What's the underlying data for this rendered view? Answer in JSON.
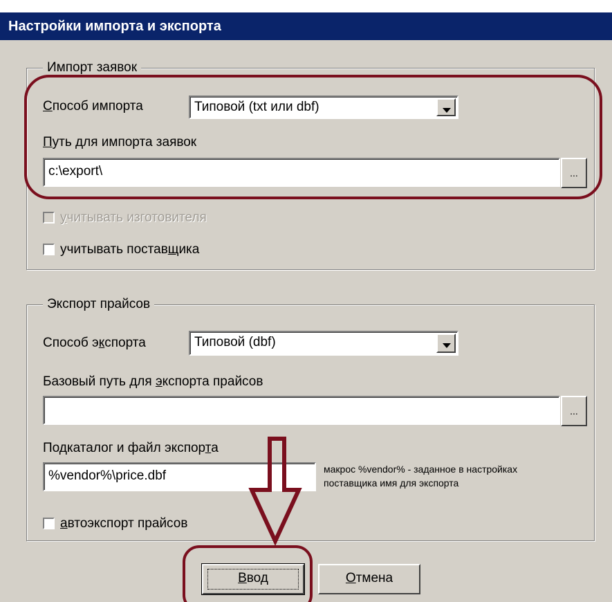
{
  "window": {
    "title": "Настройки импорта и экспорта"
  },
  "import": {
    "legend": "Импорт заявок",
    "method_label_u": "С",
    "method_label_rest": "пособ импорта",
    "method_value": "Типовой (txt или dbf)",
    "path_label_u": "П",
    "path_label_rest": "уть для импорта заявок",
    "path_value": "c:\\export\\",
    "browse_label": "...",
    "manufacturer_u": "у",
    "manufacturer_rest": "читывать изготовителя",
    "supplier_pre": "учитывать постав",
    "supplier_u": "щ",
    "supplier_post": "ика"
  },
  "export": {
    "legend": "Экспорт прайсов",
    "method_pre": "Способ э",
    "method_u": "к",
    "method_post": "спорта",
    "method_value": "Типовой (dbf)",
    "base_pre": "Базовый путь для ",
    "base_u": "э",
    "base_post": "кспорта прайсов",
    "base_value": "",
    "browse_label": "...",
    "sub_pre": "Подкаталог и файл экспор",
    "sub_u": "т",
    "sub_post": "а",
    "sub_value": "%vendor%\\price.dbf",
    "hint_line1": "макрос %vendor% - заданное в настройках",
    "hint_line2": "поставщика имя для экспорта",
    "autoexport_u": "а",
    "autoexport_rest": "втоэкспорт прайсов"
  },
  "buttons": {
    "ok_u": "В",
    "ok_rest": "вод",
    "cancel_u": "О",
    "cancel_rest": "тмена"
  },
  "colors": {
    "titlebar": "#0a246a",
    "annotation": "#7a0f1e",
    "dialog_bg": "#d4d0c8"
  }
}
